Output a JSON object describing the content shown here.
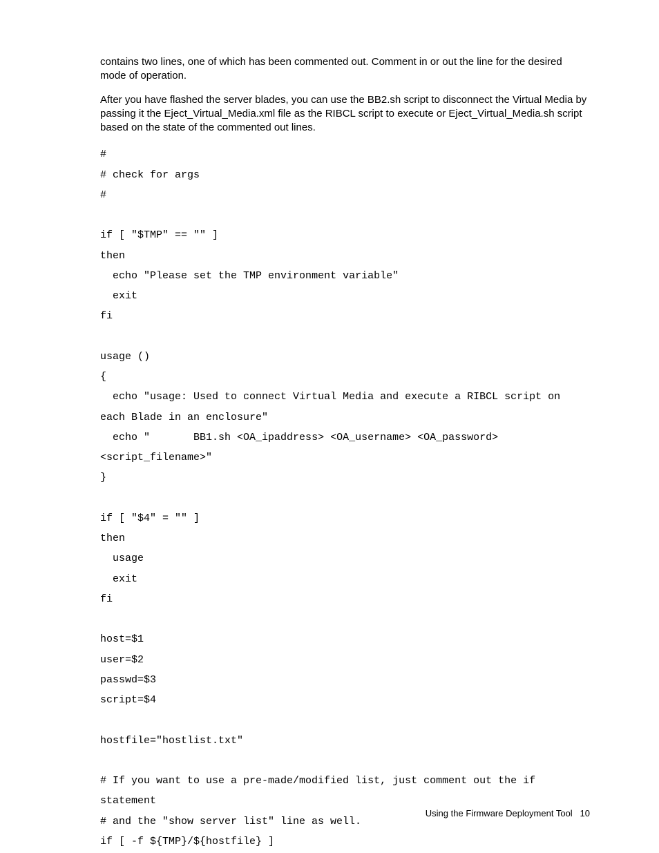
{
  "paragraphs": {
    "p1": "contains two lines, one of which has been commented out. Comment in or out the line for the desired mode of operation.",
    "p2": "After you have flashed the server blades, you can use the BB2.sh script to disconnect the Virtual Media by passing it the Eject_Virtual_Media.xml file as the RIBCL script to execute or Eject_Virtual_Media.sh script based on the state of the commented out lines."
  },
  "code": "#\n# check for args\n#\n\nif [ \"$TMP\" == \"\" ]\nthen\n  echo \"Please set the TMP environment variable\"\n  exit\nfi\n\nusage ()\n{\n  echo \"usage: Used to connect Virtual Media and execute a RIBCL script on each Blade in an enclosure\"\n  echo \"       BB1.sh <OA_ipaddress> <OA_username> <OA_password> <script_filename>\"\n}\n\nif [ \"$4\" = \"\" ]\nthen\n  usage\n  exit\nfi\n\nhost=$1\nuser=$2\npasswd=$3\nscript=$4\n\nhostfile=\"hostlist.txt\"\n\n# If you want to use a pre-made/modified list, just comment out the if statement\n# and the \"show server list\" line as well.\nif [ -f ${TMP}/${hostfile} ]",
  "footer": {
    "section": "Using the Firmware Deployment Tool",
    "page": "10"
  }
}
